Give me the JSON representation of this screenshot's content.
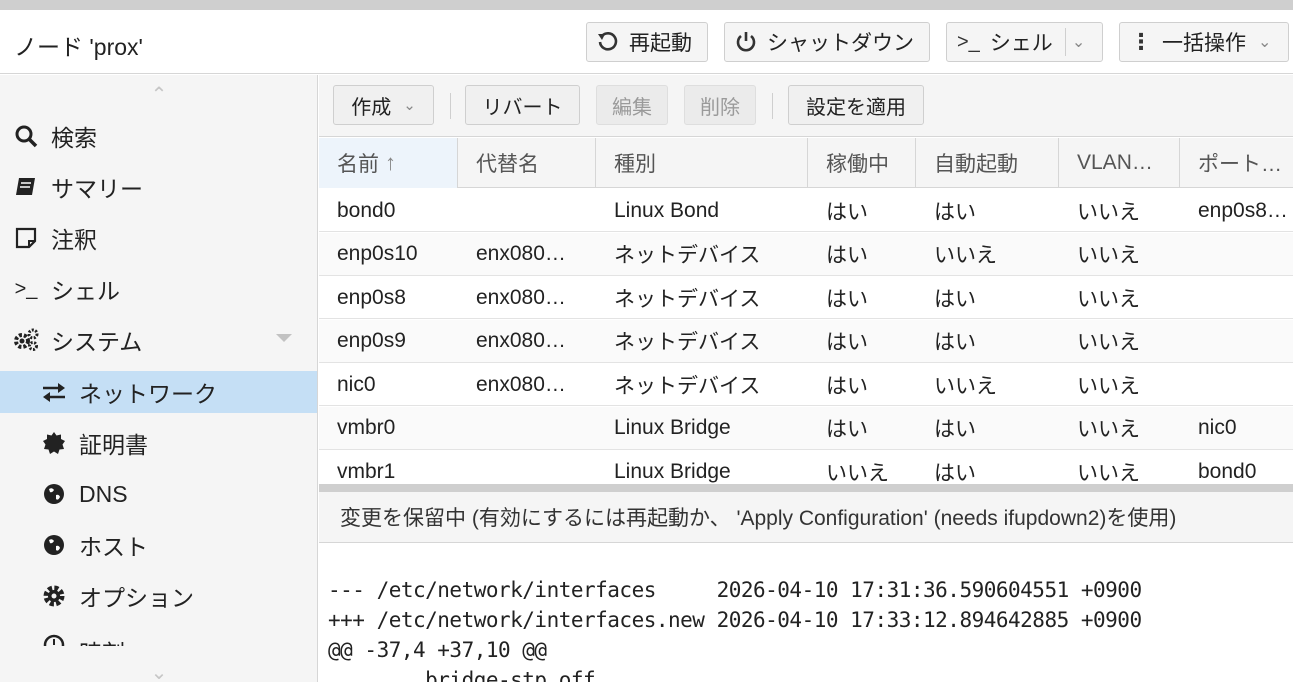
{
  "header": {
    "node_title": "ノード 'prox'",
    "reboot_label": "再起動",
    "shutdown_label": "シャットダウン",
    "shell_label": "シェル",
    "bulk_label": "一括操作"
  },
  "sidebar": {
    "items": [
      {
        "label": "検索",
        "icon": "search-icon"
      },
      {
        "label": "サマリー",
        "icon": "book-icon"
      },
      {
        "label": "注釈",
        "icon": "note-icon"
      },
      {
        "label": "シェル",
        "icon": "terminal-icon"
      },
      {
        "label": "システム",
        "icon": "gears-icon"
      },
      {
        "label": "ネットワーク",
        "icon": "exchange-icon"
      },
      {
        "label": "証明書",
        "icon": "certificate-icon"
      },
      {
        "label": "DNS",
        "icon": "globe-icon"
      },
      {
        "label": "ホスト",
        "icon": "globe-icon"
      },
      {
        "label": "オプション",
        "icon": "gear-icon"
      },
      {
        "label": "時刻",
        "icon": "clock-icon"
      }
    ]
  },
  "toolbar": {
    "create_label": "作成",
    "revert_label": "リバート",
    "edit_label": "編集",
    "delete_label": "削除",
    "apply_label": "設定を適用"
  },
  "table": {
    "columns": [
      "名前",
      "代替名",
      "種別",
      "稼働中",
      "自動起動",
      "VLAN…",
      "ポート…"
    ],
    "rows": [
      [
        "bond0",
        "",
        "Linux Bond",
        "はい",
        "はい",
        "いいえ",
        "enp0s8…"
      ],
      [
        "enp0s10",
        "enx080…",
        "ネットデバイス",
        "はい",
        "いいえ",
        "いいえ",
        ""
      ],
      [
        "enp0s8",
        "enx080…",
        "ネットデバイス",
        "はい",
        "はい",
        "いいえ",
        ""
      ],
      [
        "enp0s9",
        "enx080…",
        "ネットデバイス",
        "はい",
        "はい",
        "いいえ",
        ""
      ],
      [
        "nic0",
        "enx080…",
        "ネットデバイス",
        "はい",
        "いいえ",
        "いいえ",
        ""
      ],
      [
        "vmbr0",
        "",
        "Linux Bridge",
        "はい",
        "はい",
        "いいえ",
        "nic0"
      ],
      [
        "vmbr1",
        "",
        "Linux Bridge",
        "いいえ",
        "はい",
        "いいえ",
        "bond0"
      ]
    ]
  },
  "pending": {
    "message": "変更を保留中 (有効にするには再起動か、 'Apply Configuration' (needs ifupdown2)を使用)"
  },
  "diff": {
    "lines": [
      "--- /etc/network/interfaces     2026-04-10 17:31:36.590604551 +0900",
      "+++ /etc/network/interfaces.new 2026-04-10 17:33:12.894642885 +0900",
      "@@ -37,4 +37,10 @@",
      "        bridge-stp off"
    ]
  },
  "colors": {
    "selected_nav": "#c5dff5",
    "panel_bg": "#f5f5f5",
    "border": "#d6d6d6"
  }
}
